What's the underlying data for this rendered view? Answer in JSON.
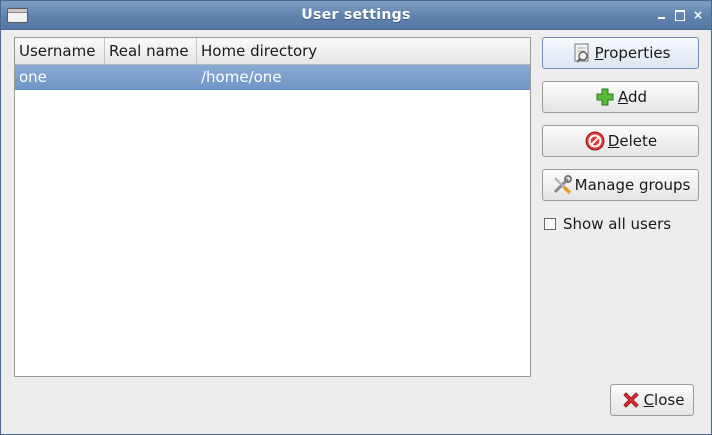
{
  "window": {
    "title": "User settings"
  },
  "list": {
    "columns": [
      "Username",
      "Real name",
      "Home directory"
    ],
    "rows": [
      {
        "username": "one",
        "real_name": "",
        "home": "/home/one",
        "selected": true
      }
    ]
  },
  "buttons": {
    "properties": {
      "mnemonic": "P",
      "rest": "roperties"
    },
    "add": {
      "mnemonic": "A",
      "rest": "dd"
    },
    "delete": {
      "mnemonic": "D",
      "rest": "elete"
    },
    "manage_groups": {
      "label": "Manage groups"
    },
    "close": {
      "mnemonic": "C",
      "rest": "lose"
    }
  },
  "options": {
    "show_all_users_label": "Show all users",
    "show_all_users_checked": false
  },
  "colors": {
    "titlebar": "#5f82ad",
    "selection": "#7a9dcb",
    "add_icon": "#4ba22e",
    "delete_icon": "#cc2a2a",
    "close_icon": "#cc2a2a"
  },
  "icons": {
    "properties": "document-properties-icon",
    "add": "plus-icon",
    "delete": "no-entry-icon",
    "manage_groups": "tools-icon",
    "close": "x-icon"
  }
}
